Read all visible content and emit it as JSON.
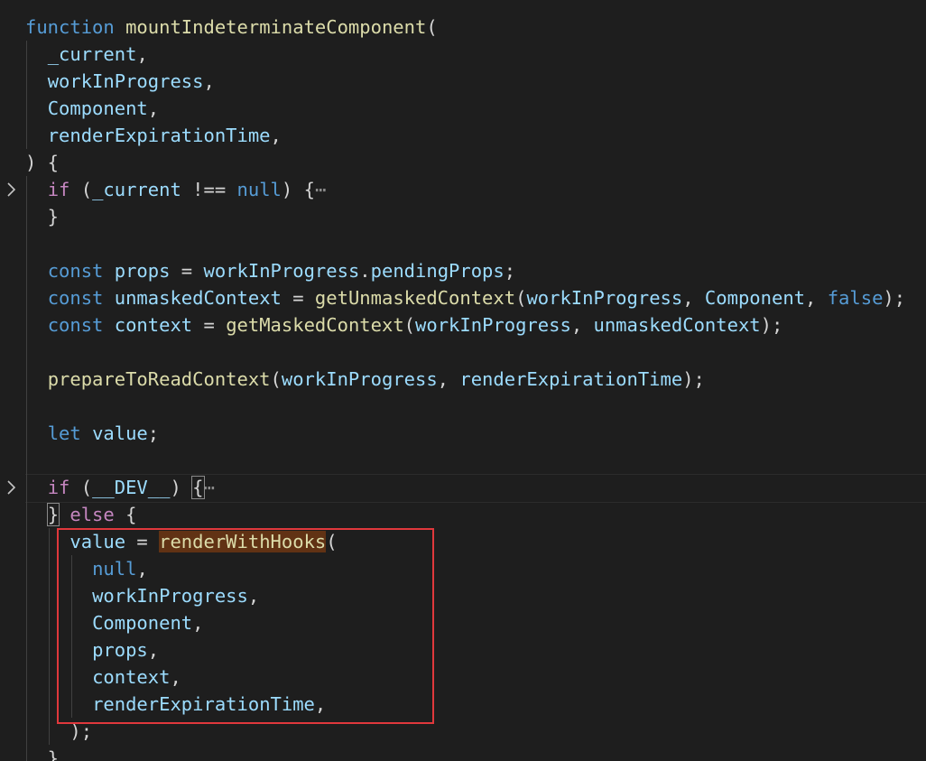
{
  "editor": {
    "function_keyword": "function",
    "function_name": "mountIndeterminateComponent",
    "params": [
      "_current",
      "workInProgress",
      "Component",
      "renderExpirationTime"
    ],
    "if_keyword": "if",
    "else_keyword": "else",
    "const_keyword": "const",
    "let_keyword": "let",
    "null_literal": "null",
    "false_literal": "false",
    "current_check_var": "_current",
    "not_equal_op": "!==",
    "fold_ellipsis": "⋯",
    "dev_flag": "__DEV__",
    "props_var": "props",
    "pending_props_member": "pendingProps",
    "unmasked_context_var": "unmaskedContext",
    "get_unmasked_context_fn": "getUnmaskedContext",
    "context_var": "context",
    "get_masked_context_fn": "getMaskedContext",
    "prepare_fn": "prepareToReadContext",
    "value_var": "value",
    "render_with_hooks_fn": "renderWithHooks",
    "render_args": [
      "null",
      "workInProgress",
      "Component",
      "props",
      "context",
      "renderExpirationTime"
    ]
  },
  "colors": {
    "background": "#1e1e1e",
    "keyword": "#569cd6",
    "control_keyword": "#c586c0",
    "function": "#dcdcaa",
    "variable": "#9cdcfe",
    "punctuation": "#d4d4d4",
    "word_highlight": "#613214",
    "annotation_box": "#e0383c"
  }
}
